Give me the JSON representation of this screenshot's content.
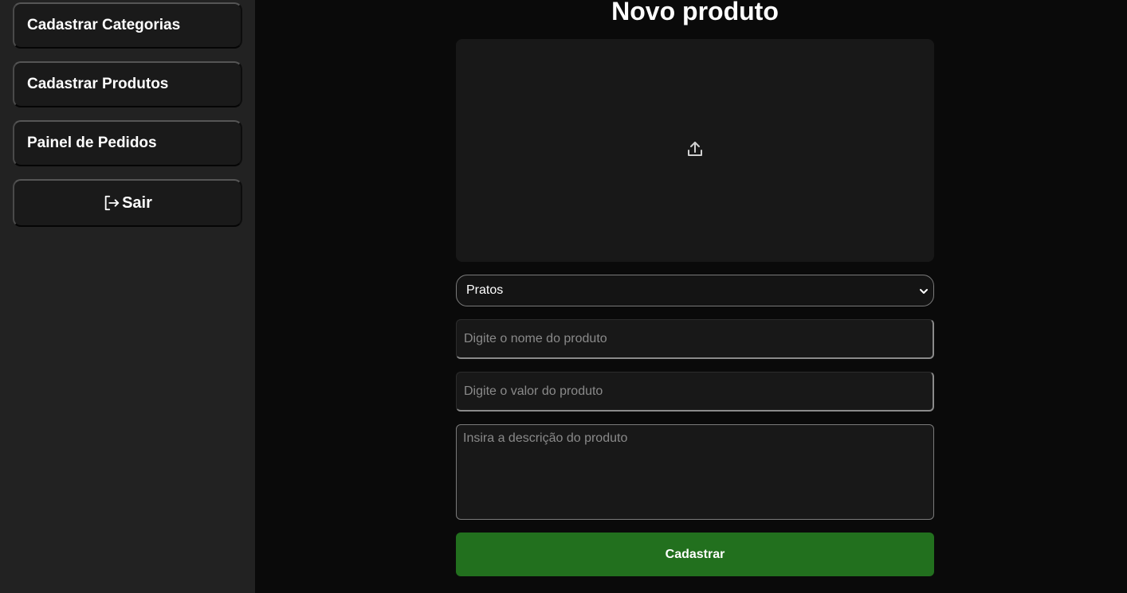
{
  "sidebar": {
    "items": [
      {
        "label": "Cadastrar Categorias"
      },
      {
        "label": "Cadastrar Produtos"
      },
      {
        "label": "Painel de Pedidos"
      }
    ],
    "logout": {
      "label": "Sair",
      "icon": "logout-icon"
    }
  },
  "main": {
    "title": "Novo produto",
    "upload": {
      "icon": "upload-icon"
    },
    "category_select": {
      "selected": "Pratos"
    },
    "name_input": {
      "value": "",
      "placeholder": "Digite o nome do produto"
    },
    "price_input": {
      "value": "",
      "placeholder": "Digite o valor do produto"
    },
    "description_input": {
      "value": "",
      "placeholder": "Insira a descrição do produto"
    },
    "submit_label": "Cadastrar"
  },
  "colors": {
    "background": "#0a0a0a",
    "sidebar": "#222222",
    "submit_button": "#22701e",
    "text": "#ffffff"
  }
}
